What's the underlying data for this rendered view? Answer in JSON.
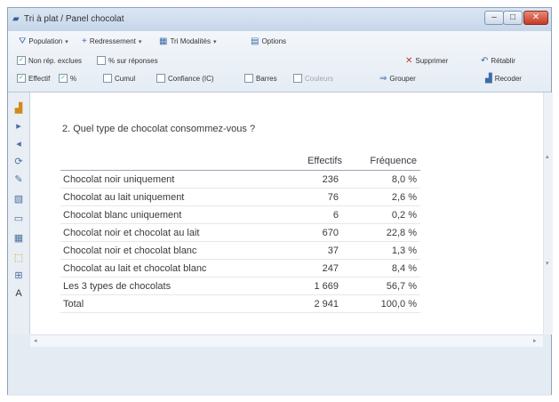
{
  "window": {
    "title": "Tri à plat / Panel chocolat"
  },
  "toolbar": {
    "population": "Population",
    "redressement": "Redressement",
    "tri_modalites": "Tri Modalités",
    "options": "Options",
    "non_rep_exclues": "Non rép. exclues",
    "pct_sur_reponses": "% sur réponses",
    "supprimer": "Supprimer",
    "retablir": "Rétablir",
    "effectif": "Effectif",
    "pct": "%",
    "cumul": "Cumul",
    "confiance": "Confiance (IC)",
    "barres": "Barres",
    "couleurs": "Couleurs",
    "grouper": "Grouper",
    "recoder": "Recoder"
  },
  "checkboxes": {
    "non_rep_exclues": true,
    "pct_sur_reponses": false,
    "effectif": true,
    "pct": true,
    "cumul": false,
    "confiance": false,
    "barres": false,
    "couleurs": false
  },
  "question": "2. Quel type de chocolat consommez-vous ?",
  "table": {
    "headers": [
      "Effectifs",
      "Fréquence"
    ],
    "rows": [
      {
        "label": "Chocolat noir uniquement",
        "count": "236",
        "freq": "8,0 %"
      },
      {
        "label": "Chocolat au lait uniquement",
        "count": "76",
        "freq": "2,6 %"
      },
      {
        "label": "Chocolat blanc uniquement",
        "count": "6",
        "freq": "0,2 %"
      },
      {
        "label": "Chocolat noir et chocolat au lait",
        "count": "670",
        "freq": "22,8 %"
      },
      {
        "label": "Chocolat noir et chocolat blanc",
        "count": "37",
        "freq": "1,3 %"
      },
      {
        "label": "Chocolat au lait et chocolat blanc",
        "count": "247",
        "freq": "8,4 %"
      },
      {
        "label": "Les 3 types de chocolats",
        "count": "1 669",
        "freq": "56,7 %"
      }
    ],
    "total": {
      "label": "Total",
      "count": "2 941",
      "freq": "100,0 %"
    }
  }
}
